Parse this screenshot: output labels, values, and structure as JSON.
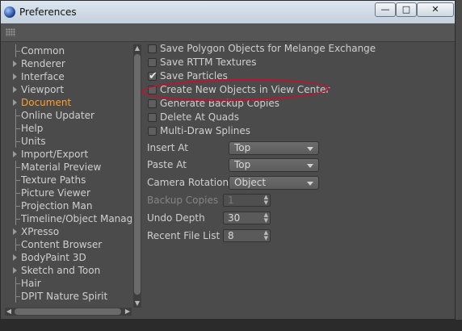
{
  "window": {
    "title": "Preferences",
    "controls": {
      "minimize": "—",
      "maximize": "□",
      "close": "✕"
    }
  },
  "icons": {
    "app": "cinema4d-sphere-icon",
    "grip": "grip-icon"
  },
  "nav": {
    "items": [
      {
        "label": "Common",
        "expandable": false
      },
      {
        "label": "Renderer",
        "expandable": true
      },
      {
        "label": "Interface",
        "expandable": true
      },
      {
        "label": "Viewport",
        "expandable": true
      },
      {
        "label": "Document",
        "expandable": true,
        "active": true
      },
      {
        "label": "Online Updater",
        "expandable": false
      },
      {
        "label": "Help",
        "expandable": false
      },
      {
        "label": "Units",
        "expandable": false
      },
      {
        "label": "Import/Export",
        "expandable": true
      },
      {
        "label": "Material Preview",
        "expandable": false
      },
      {
        "label": "Texture Paths",
        "expandable": false
      },
      {
        "label": "Picture Viewer",
        "expandable": false
      },
      {
        "label": "Projection Man",
        "expandable": false
      },
      {
        "label": "Timeline/Object Manager",
        "expandable": false
      },
      {
        "label": "XPresso",
        "expandable": true
      },
      {
        "label": "Content Browser",
        "expandable": false
      },
      {
        "label": "BodyPaint 3D",
        "expandable": true
      },
      {
        "label": "Sketch and Toon",
        "expandable": true
      },
      {
        "label": "Hair",
        "expandable": false
      },
      {
        "label": "DPIT Nature Spirit",
        "expandable": false
      }
    ],
    "active_color": "#ff9d2e"
  },
  "options": {
    "checkboxes": [
      {
        "label": "Save Polygon Objects for Melange Exchange",
        "checked": false
      },
      {
        "label": "Save RTTM Textures",
        "checked": false
      },
      {
        "label": "Save Particles",
        "checked": true
      },
      {
        "label": "Create New Objects in View Center",
        "checked": false
      },
      {
        "label": "Generate Backup Copies",
        "checked": false
      },
      {
        "label": "Delete At Quads",
        "checked": false
      },
      {
        "label": "Multi-Draw Splines",
        "checked": false
      }
    ],
    "insert_at": {
      "label": "Insert At",
      "value": "Top"
    },
    "paste_at": {
      "label": "Paste At",
      "value": "Top"
    },
    "camera_rotation": {
      "label": "Camera Rotation",
      "value": "Object"
    },
    "backup_copies": {
      "label": "Backup Copies",
      "value": "1"
    },
    "undo_depth": {
      "label": "Undo Depth",
      "value": "30"
    },
    "recent_file_list": {
      "label": "Recent File List",
      "value": "8"
    }
  },
  "annotation": {
    "color": "#c8102e"
  }
}
